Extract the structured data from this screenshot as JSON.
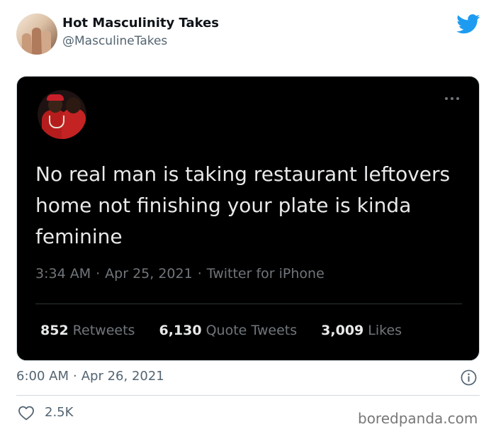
{
  "author": {
    "display_name": "Hot Masculinity Takes",
    "handle": "@MasculineTakes",
    "avatar_icon": "profile-photo"
  },
  "brand_icon": "twitter-bird-icon",
  "brand_color": "#1d9bf0",
  "embedded_tweet": {
    "background": "#000000",
    "avatar_icon": "profile-photo",
    "menu_icon": "more-icon",
    "text": "No real man is taking restaurant leftovers home not finishing your plate is kinda feminine",
    "time": "3:34 AM",
    "date": "Apr 25, 2021",
    "client": "Twitter for iPhone",
    "separator": "·",
    "stats": [
      {
        "value": "852",
        "label": "Retweets"
      },
      {
        "value": "6,130",
        "label": "Quote Tweets"
      },
      {
        "value": "3,009",
        "label": "Likes"
      }
    ]
  },
  "footer": {
    "time": "6:00 AM",
    "date": "Apr 26, 2021",
    "separator": "·",
    "info_icon": "info-icon",
    "heart_icon": "heart-icon",
    "like_count": "2.5K"
  },
  "watermark": "boredpanda.com"
}
